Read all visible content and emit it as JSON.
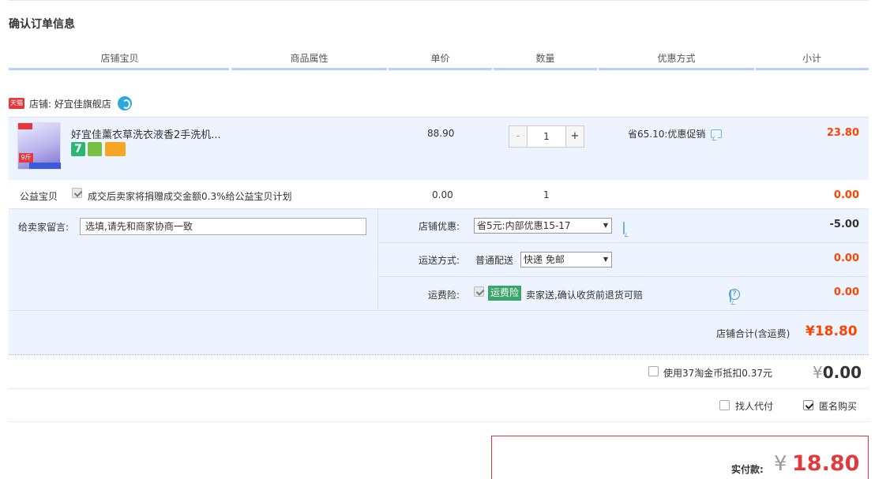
{
  "page_title": "确认订单信息",
  "columns": [
    "店铺宝贝",
    "商品属性",
    "单价",
    "数量",
    "优惠方式",
    "小计"
  ],
  "shop": {
    "badge": "天猫",
    "label": "店铺: 好宜佳旗舰店",
    "icon": "wangwang-chat-icon"
  },
  "item": {
    "name": "好宜佳薰衣草洗衣液香2手洗机...",
    "image_badges": {
      "top_left": "超值装",
      "weight": "9斤",
      "band": "送手机 买送"
    },
    "service_badges": [
      "7",
      "shield",
      "card"
    ],
    "price": "88.90",
    "quantity": "1",
    "qty_minus": "-",
    "qty_plus": "+",
    "promo": "省65.10:优惠促销",
    "subtotal": "23.80"
  },
  "charity": {
    "label": "公益宝贝",
    "checked": true,
    "text": "成交后卖家将捐赠成交金额0.3%给公益宝贝计划",
    "price": "0.00",
    "quantity": "1",
    "subtotal": "0.00"
  },
  "message": {
    "label": "给卖家留言:",
    "placeholder": "选填,请先和商家协商一致"
  },
  "shop_discount": {
    "label": "店铺优惠:",
    "selected": "省5元:内部优惠15-17",
    "amount": "-5.00"
  },
  "shipping": {
    "label": "运送方式:",
    "type": "普通配送",
    "selected": "快递 免邮",
    "amount": "0.00"
  },
  "insurance": {
    "label": "运费险:",
    "checked": true,
    "badge": "运费险",
    "text": "卖家送,确认收货前退货可赔",
    "amount": "0.00"
  },
  "shop_total": {
    "label": "店铺合计(含运费)",
    "value": "¥18.80"
  },
  "taobao_coin": {
    "label": "使用37淘金币抵扣0.37元",
    "checked": false,
    "yen": "¥",
    "value": "0.00"
  },
  "options": {
    "proxy_pay_label": "找人代付",
    "proxy_pay_checked": false,
    "anonymous_label": "匿名购买",
    "anonymous_checked": true
  },
  "payment": {
    "label": "实付款:",
    "yen": "¥",
    "value": "18.80"
  },
  "colors": {
    "accent": "#ff4400",
    "header_bar": "#b2d1ff",
    "row_bg": "#eef4ff",
    "pay_border": "#e4393c"
  }
}
